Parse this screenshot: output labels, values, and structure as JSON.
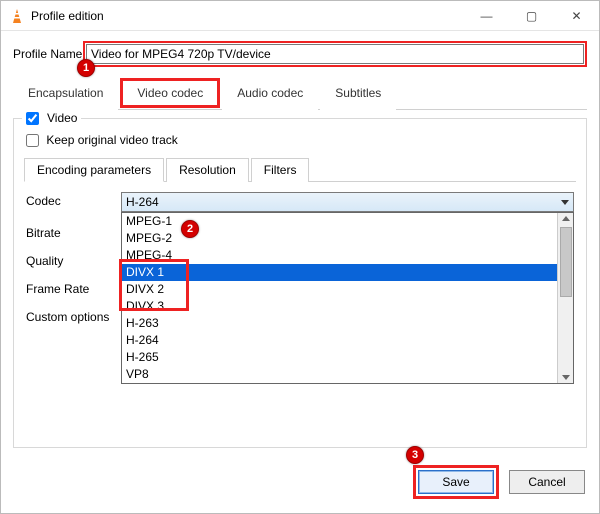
{
  "window": {
    "title": "Profile edition"
  },
  "profile": {
    "label": "Profile Name",
    "value": "Video for MPEG4 720p TV/device"
  },
  "tabs_top": {
    "encapsulation": "Encapsulation",
    "video_codec": "Video codec",
    "audio_codec": "Audio codec",
    "subtitles": "Subtitles"
  },
  "group": {
    "video_label": "Video",
    "keep_original": "Keep original video track"
  },
  "inner_tabs": {
    "encoding": "Encoding parameters",
    "resolution": "Resolution",
    "filters": "Filters"
  },
  "params": {
    "codec": "Codec",
    "bitrate": "Bitrate",
    "quality": "Quality",
    "frame_rate": "Frame Rate",
    "custom": "Custom options"
  },
  "codec_selected": "H-264",
  "codec_options": {
    "o0": "MPEG-1",
    "o1": "MPEG-2",
    "o2": "MPEG-4",
    "o3": "DIVX 1",
    "o4": "DIVX 2",
    "o5": "DIVX 3",
    "o6": "H-263",
    "o7": "H-264",
    "o8": "H-265",
    "o9": "VP8"
  },
  "buttons": {
    "save": "Save",
    "cancel": "Cancel"
  },
  "annotations": {
    "b1": "1",
    "b2": "2",
    "b3": "3"
  }
}
